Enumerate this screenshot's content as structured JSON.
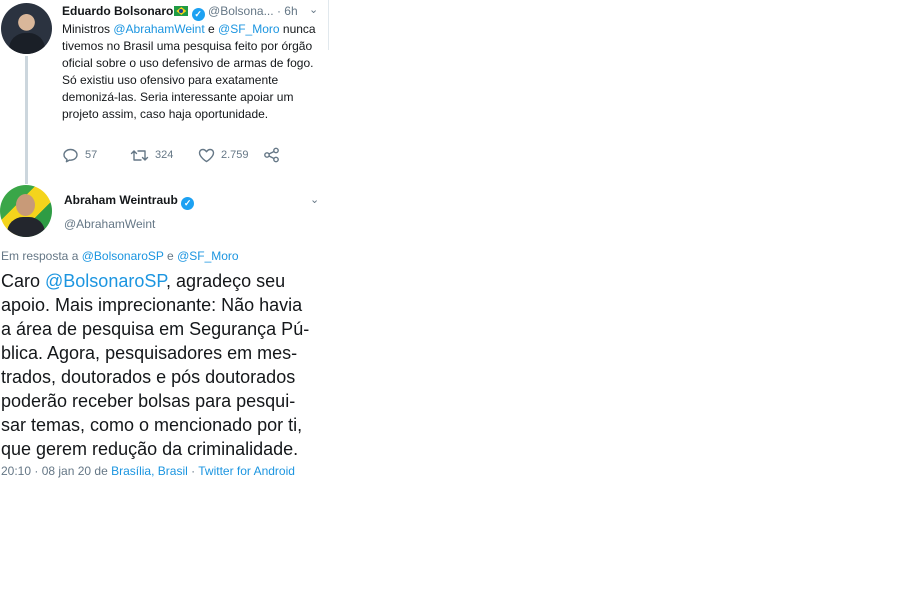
{
  "colors": {
    "link": "#1b95e0",
    "muted": "#657786",
    "text": "#14171a",
    "verified": "#1da1f2"
  },
  "tweet1": {
    "name": "Eduardo Bolsonaro",
    "handle": "@Bolsona...",
    "time": "· 6h",
    "body_pre": "Ministros ",
    "mention1": "@AbrahamWeint",
    "body_and": " e ",
    "mention2": "@SF_Moro",
    "body_rest": " nunca tivemos no Brasil uma pesquisa feito por órgão oficial sobre o uso defensivo de armas de fogo. Só existiu uso ofensivo para exatamente demonizá-las. Seria interessante apoiar um projeto assim, caso haja oportunidade.",
    "replies": "57",
    "retweets": "324",
    "likes": "2.759",
    "icons": [
      "reply-icon",
      "retweet-icon",
      "like-icon",
      "share-icon",
      "verified-icon",
      "brazil-flag-icon",
      "chevron-down-icon"
    ]
  },
  "tweet2": {
    "name": "Abraham Weintraub",
    "handle": "@AbrahamWeint",
    "reply_prefix": "Em resposta a ",
    "reply_mention1": "@BolsonaroSP",
    "reply_and": " e ",
    "reply_mention2": "@SF_Moro",
    "text_pre": "Caro ",
    "text_mention": "@BolsonaroSP",
    "text_rest": ", agradeço seu\napoio. Mais imprecionante: Não havia\na área de pesquisa em Segurança Pú-\nblica. Agora, pesquisadores em mes-\ntrados, doutorados e pós doutorados\npoderão receber bolsas para pesqui-\nsar temas, como o mencionado por ti,\nque gerem redução da criminalidade.",
    "timestamp": "20:10 · 08 jan 20 de ",
    "location": "Brasília, Brasil",
    "separator": " · ",
    "source": "Twitter for Android"
  }
}
